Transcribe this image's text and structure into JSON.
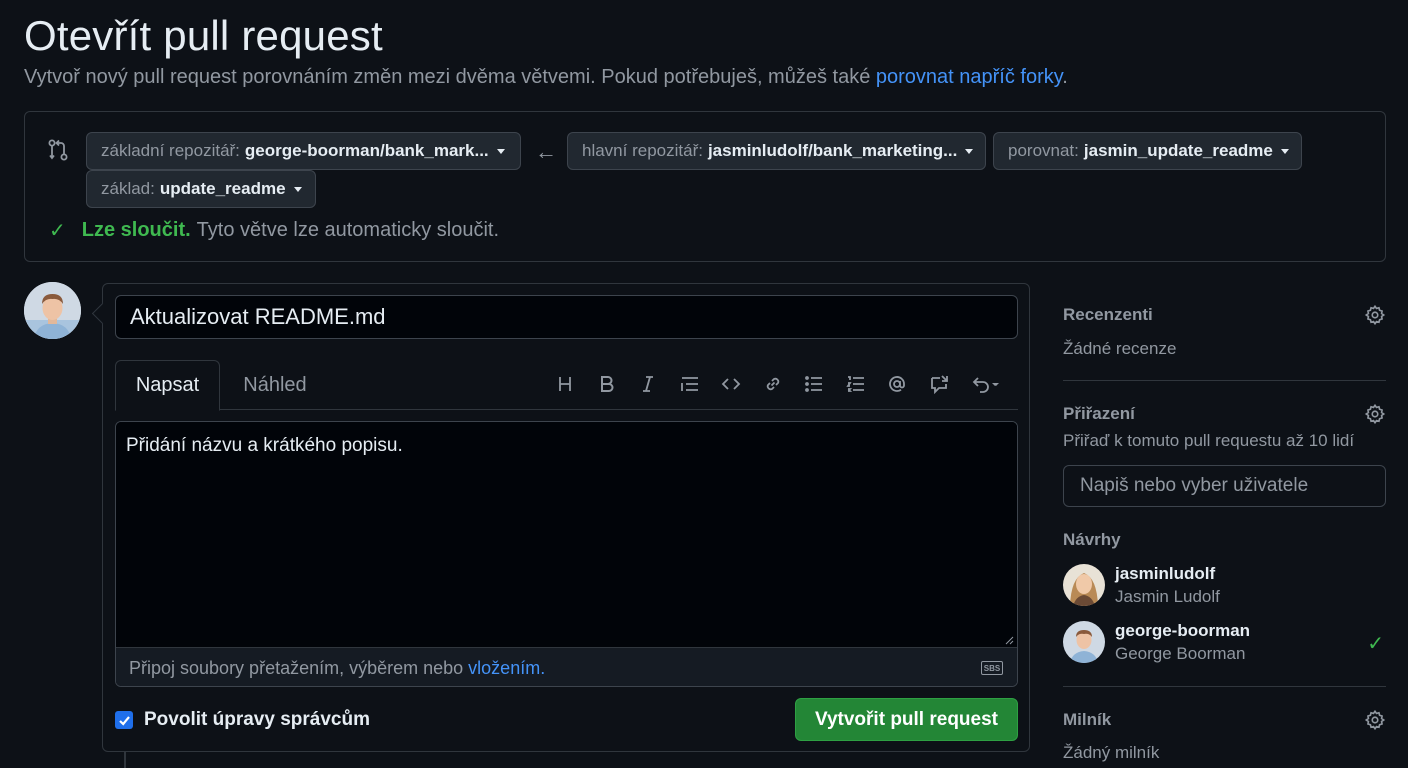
{
  "page": {
    "title": "Otevřít pull request",
    "subtitle": "Vytvoř nový pull request porovnáním změn mezi dvěma větvemi. Pokud potřebuješ, můžeš také ",
    "subtitle_link": "porovnat napříč forky",
    "subtitle_end": "."
  },
  "compare": {
    "base_repo_label": "základní repozitář:",
    "base_repo_value": "george-boorman/bank_mark...",
    "head_repo_label": "hlavní repozitář:",
    "head_repo_value": "jasminludolf/bank_marketing...",
    "compare_label": "porovnat:",
    "compare_value": "jasmin_update_readme",
    "base_label": "základ:",
    "base_value": "update_readme",
    "status_ok": "Lze sloučit.",
    "status_text": "Tyto větve lze automaticky sloučit."
  },
  "composer": {
    "title_value": "Aktualizovat README.md",
    "tab_write": "Napsat",
    "tab_preview": "Náhled",
    "body_value": "Přidání názvu a krátkého popisu.",
    "attach_text": "Připoj soubory přetažením, výběrem nebo",
    "attach_link": "vložením.",
    "markdown_icon_text": "SBS",
    "allow_edits_label": "Povolit úpravy správcům",
    "allow_edits_checked": true,
    "submit_label": "Vytvořit pull request",
    "toolbar_icons": [
      "heading-icon",
      "bold-icon",
      "italic-icon",
      "quote-icon",
      "code-icon",
      "link-icon",
      "unordered-list-icon",
      "ordered-list-icon",
      "mention-icon",
      "reference-icon",
      "undo-icon"
    ]
  },
  "sidebar": {
    "reviewers_title": "Recenzenti",
    "reviewers_value": "Žádné recenze",
    "assignees_title": "Přiřazení",
    "assignees_hint": "Přiřaď k tomuto pull requestu až 10 lidí",
    "assignees_placeholder": "Napiš nebo vyber uživatele",
    "suggestions_title": "Návrhy",
    "suggestions": [
      {
        "login": "jasminludolf",
        "name": "Jasmin Ludolf",
        "selected": false
      },
      {
        "login": "george-boorman",
        "name": "George Boorman",
        "selected": true
      }
    ],
    "milestone_title": "Milník",
    "milestone_value": "Žádný milník"
  },
  "colors": {
    "background": "#0d1117",
    "accent_link": "#4493f8",
    "success": "#3fb950",
    "primary_button": "#238636"
  }
}
